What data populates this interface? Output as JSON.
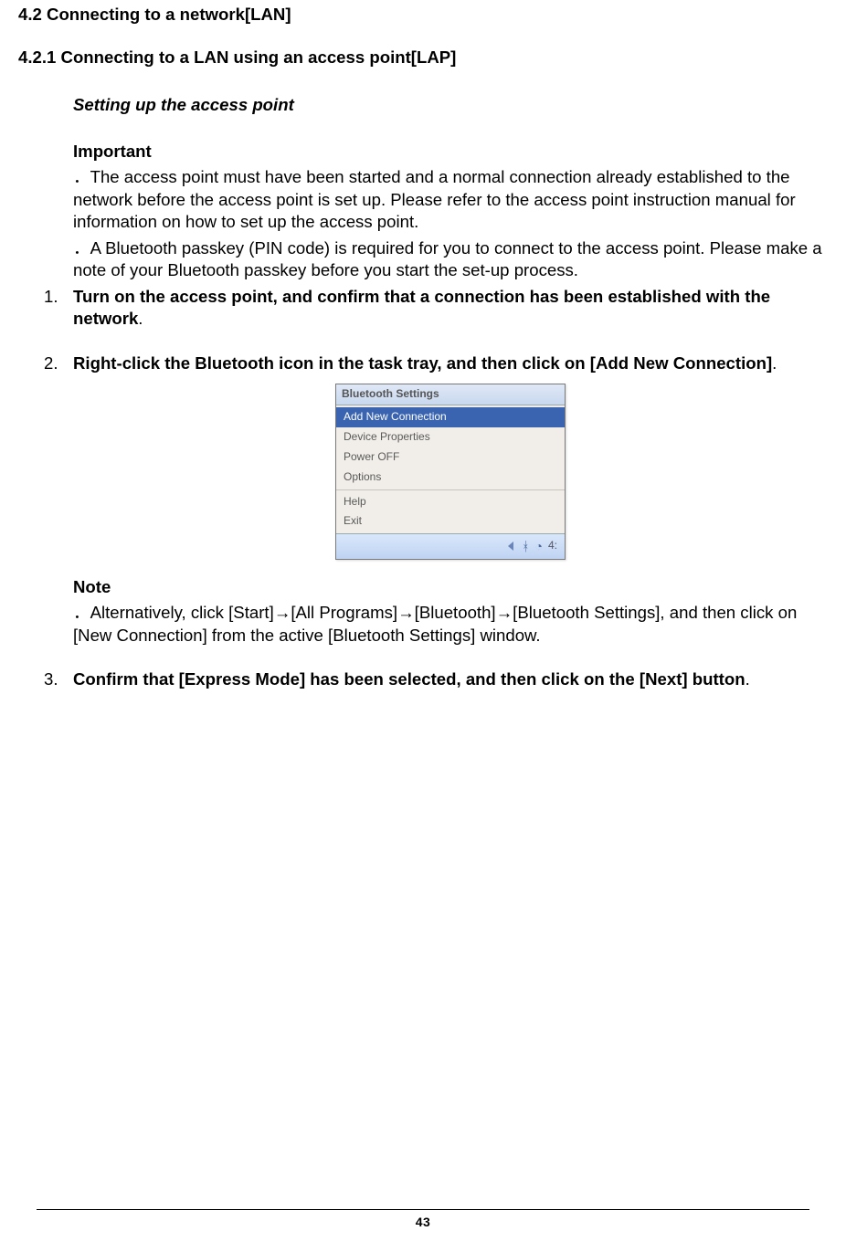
{
  "headings": {
    "h42": "4.2  Connecting to a network[LAN]",
    "h421": "4.2.1    Connecting to a LAN using an access point[LAP]",
    "h3": "Setting up the access point"
  },
  "important": {
    "label": "Important",
    "bullets": [
      "．The access point must have been started and a normal connection already established to the network before the access point is set up. Please refer to the access point instruction manual for information on how to set up the access point.",
      "．A Bluetooth passkey (PIN code) is required for you to connect to the access point. Please make a note of your Bluetooth passkey before you start the set-up process."
    ]
  },
  "steps": [
    {
      "num": "1.",
      "bold": "Turn on the access point, and confirm that a connection has been established with the network",
      "tail": "."
    },
    {
      "num": "2.",
      "bold": "Right-click the Bluetooth icon in the task tray, and then click on [Add New Connection]",
      "tail": "."
    },
    {
      "num": "3.",
      "bold": "Confirm that [Express Mode] has been selected, and then click on the [Next] button",
      "tail": "."
    }
  ],
  "note": {
    "label": "Note",
    "text": "．Alternatively, click [Start]→[All Programs]→[Bluetooth]→[Bluetooth Settings], and then click on [New Connection] from the active [Bluetooth Settings] window."
  },
  "context_menu": {
    "title": "Bluetooth Settings",
    "items": [
      "Add New Connection",
      "Device Properties",
      "Power OFF",
      "Options"
    ],
    "items2": [
      "Help",
      "Exit"
    ],
    "selected_index": 0,
    "tray_time": "4:"
  },
  "page_number": "43"
}
